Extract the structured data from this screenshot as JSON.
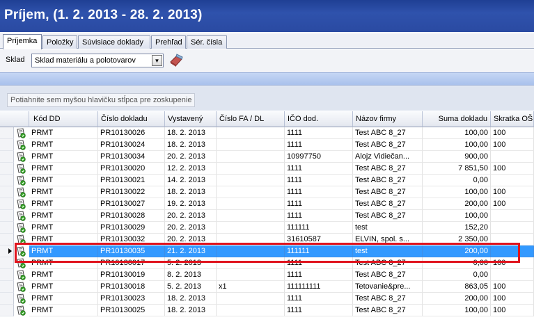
{
  "window": {
    "title": "Príjem,  (1. 2. 2013 - 28. 2. 2013)"
  },
  "tabs": [
    {
      "label": "Príjemka",
      "active": true
    },
    {
      "label": "Položky"
    },
    {
      "label": "Súvisiace doklady"
    },
    {
      "label": "Prehľad"
    },
    {
      "label": "Sér. čísla"
    }
  ],
  "toolbar": {
    "sklad_label": "Sklad",
    "sklad_value": "Sklad materiálu a polotovarov"
  },
  "grid": {
    "group_hint": "Potiahnite sem myšou hlavičku stĺpca pre zoskupenie",
    "columns": [
      "Kód DD",
      "Číslo dokladu",
      "Vystavený",
      "Číslo FA / DL",
      "IČO dod.",
      "Názov firmy",
      "Suma dokladu",
      "Skratka OŠ"
    ],
    "rows": [
      [
        "PRMT",
        "PR10130026",
        "18. 2. 2013",
        "",
        "1111",
        "Test ABC 8_27",
        "100,00",
        "100"
      ],
      [
        "PRMT",
        "PR10130024",
        "18. 2. 2013",
        "",
        "1111",
        "Test ABC 8_27",
        "100,00",
        "100"
      ],
      [
        "PRMT",
        "PR10130034",
        "20. 2. 2013",
        "",
        "10997750",
        "Alojz Vidiečan...",
        "900,00",
        ""
      ],
      [
        "PRMT",
        "PR10130020",
        "12. 2. 2013",
        "",
        "1111",
        "Test ABC 8_27",
        "7 851,50",
        "100"
      ],
      [
        "PRMT",
        "PR10130021",
        "14. 2. 2013",
        "",
        "1111",
        "Test ABC 8_27",
        "0,00",
        ""
      ],
      [
        "PRMT",
        "PR10130022",
        "18. 2. 2013",
        "",
        "1111",
        "Test ABC 8_27",
        "100,00",
        "100"
      ],
      [
        "PRMT",
        "PR10130027",
        "19. 2. 2013",
        "",
        "1111",
        "Test ABC 8_27",
        "200,00",
        "100"
      ],
      [
        "PRMT",
        "PR10130028",
        "20. 2. 2013",
        "",
        "1111",
        "Test ABC 8_27",
        "100,00",
        ""
      ],
      [
        "PRMT",
        "PR10130029",
        "20. 2. 2013",
        "",
        "111111",
        "test",
        "152,20",
        ""
      ],
      [
        "PRMT",
        "PR10130032",
        "20. 2. 2013",
        "",
        "31610587",
        "ELVIN, spol. s...",
        "2 350,00",
        ""
      ],
      [
        "PRMT",
        "PR10130035",
        "21. 2. 2013",
        "",
        "111111",
        "test",
        "200,00",
        ""
      ],
      [
        "PRMT",
        "PR10130017",
        "5. 2. 2013",
        "",
        "1111",
        "Test ABC 8_27",
        "0,00",
        "100"
      ],
      [
        "PRMT",
        "PR10130019",
        "8. 2. 2013",
        "",
        "1111",
        "Test ABC 8_27",
        "0,00",
        ""
      ],
      [
        "PRMT",
        "PR10130018",
        "5. 2. 2013",
        "x1",
        "111111111",
        "Tetovanie&pre...",
        "863,05",
        "100"
      ],
      [
        "PRMT",
        "PR10130023",
        "18. 2. 2013",
        "",
        "1111",
        "Test ABC 8_27",
        "200,00",
        "100"
      ],
      [
        "PRMT",
        "PR10130025",
        "18. 2. 2013",
        "",
        "1111",
        "Test ABC 8_27",
        "100,00",
        "100"
      ]
    ],
    "selected_row": 10
  },
  "colors": {
    "title_bg": "#2a4aa2",
    "selection": "#3399ff",
    "highlight_box": "#e0141e"
  }
}
